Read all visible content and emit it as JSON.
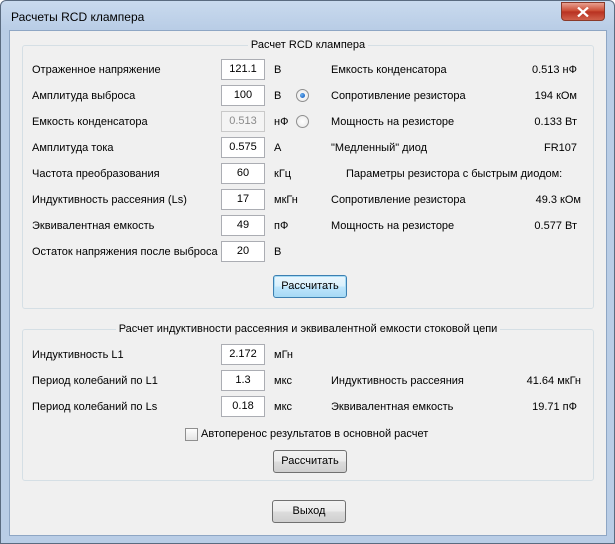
{
  "window": {
    "title": "Расчеты RCD клампера",
    "close_glyph": "✕"
  },
  "rcd": {
    "group_title": "Расчет RCD клампера",
    "inputs": [
      {
        "label": "Отраженное напряжение",
        "value": "121.1",
        "unit": "В"
      },
      {
        "label": "Амплитуда выброса",
        "value": "100",
        "unit": "В",
        "radio": "selected"
      },
      {
        "label": "Емкость конденсатора",
        "value": "0.513",
        "unit": "нФ",
        "radio": "unselected",
        "disabled": true
      },
      {
        "label": "Амплитуда тока",
        "value": "0.575",
        "unit": "А"
      },
      {
        "label": "Частота преобразования",
        "value": "60",
        "unit": "кГц"
      },
      {
        "label": "Индуктивность рассеяния (Ls)",
        "value": "17",
        "unit": "мкГн"
      },
      {
        "label": "Эквивалентная емкость",
        "value": "49",
        "unit": "пФ"
      },
      {
        "label": "Остаток напряжения после выброса",
        "value": "20",
        "unit": "В"
      }
    ],
    "results": [
      {
        "label": "Емкость конденсатора",
        "value": "0.513 нФ"
      },
      {
        "label": "Сопротивление резистора",
        "value": "194 кОм"
      },
      {
        "label": "Мощность на резисторе",
        "value": "0.133 Вт"
      },
      {
        "label": "\"Медленный\" диод",
        "value": "FR107"
      }
    ],
    "fast_diode_header": "Параметры резистора с быстрым диодом:",
    "fast_results": [
      {
        "label": "Сопротивление резистора",
        "value": "49.3 кОм"
      },
      {
        "label": "Мощность на резисторе",
        "value": "0.577 Вт"
      }
    ],
    "calc_button": "Рассчитать"
  },
  "leak": {
    "group_title": "Расчет индуктивности рассеяния и эквивалентной емкости стоковой цепи",
    "inputs": [
      {
        "label": "Индуктивность L1",
        "value": "2.172",
        "unit": "мГн"
      },
      {
        "label": "Период колебаний по L1",
        "value": "1.3",
        "unit": "мкс"
      },
      {
        "label": "Период колебаний по Ls",
        "value": "0.18",
        "unit": "мкс"
      }
    ],
    "results": [
      {
        "label": "Индуктивность рассеяния",
        "value": "41.64 мкГн"
      },
      {
        "label": "Эквивалентная емкость",
        "value": "19.71 пФ"
      }
    ],
    "autotransfer_label": "Автоперенос результатов в основной расчет",
    "autotransfer_checked": false,
    "calc_button": "Рассчитать"
  },
  "exit_button": "Выход"
}
